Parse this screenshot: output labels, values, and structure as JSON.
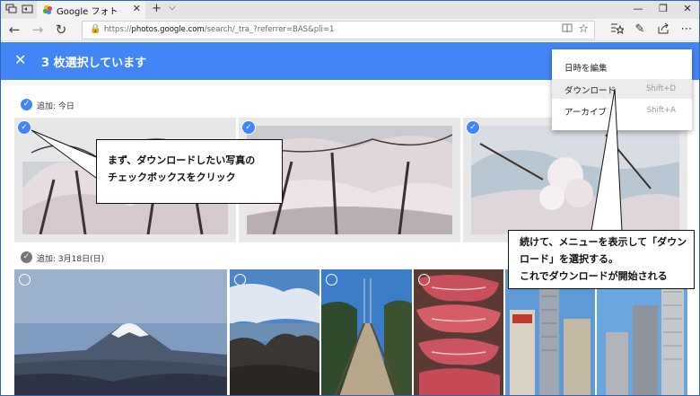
{
  "browser": {
    "tab_title": "Google フォト",
    "url_prefix": "https://",
    "url_host": "photos.google.com",
    "url_path": "/search/_tra_?referrer=BAS&pli=1",
    "icons": {
      "tab_back": "tab-set-aside-icon",
      "tab_preview": "tab-preview-icon",
      "favicon": "google-photos-pinwheel-icon",
      "new_tab": "plus-icon",
      "tab_list": "chevron-down-icon",
      "minimize": "minimize-icon",
      "restore": "restore-icon",
      "close": "close-icon",
      "back": "arrow-left-icon",
      "forward": "arrow-right-icon",
      "refresh": "refresh-icon",
      "lock": "lock-icon",
      "reader": "reading-view-icon",
      "favorite": "star-icon",
      "favorites_hub": "favorites-hub-icon",
      "notes": "pen-icon",
      "share": "share-icon",
      "more": "more-horizontal-icon"
    }
  },
  "selection_bar": {
    "close_glyph": "✕",
    "count_label": "3 枚選択しています",
    "color": "#4285f4"
  },
  "sections": [
    {
      "label": "追加: 今日",
      "checked": true
    },
    {
      "label": "追加: 3月18日(日)",
      "checked": false
    }
  ],
  "photos_today": [
    {
      "subject": "cherry-blossoms",
      "selected": true
    },
    {
      "subject": "cherry-blossoms",
      "selected": true
    },
    {
      "subject": "cherry-blossoms-closeup",
      "selected": true
    }
  ],
  "photos_march18": [
    {
      "subject": "mount-fuji",
      "selected": false
    },
    {
      "subject": "coastal-rocks",
      "selected": false
    },
    {
      "subject": "suspension-bridge",
      "selected": false
    },
    {
      "subject": "raw-beef",
      "selected": false
    },
    {
      "subject": "city-buildings",
      "selected": false
    },
    {
      "subject": "city-buildings",
      "selected": false
    }
  ],
  "menu": {
    "items": [
      {
        "label": "日時を編集",
        "shortcut": ""
      },
      {
        "label": "ダウンロード",
        "shortcut": "Shift+D",
        "highlighted": true
      },
      {
        "label": "アーカイブ",
        "shortcut": "Shift+A"
      }
    ]
  },
  "callouts": {
    "first": "まず、ダウンロードしたい写真の\nチェックボックスをクリック",
    "second": "続けて、メニューを表示して「ダウン\nロード」を選択する。\nこれでダウンロードが開始される"
  }
}
